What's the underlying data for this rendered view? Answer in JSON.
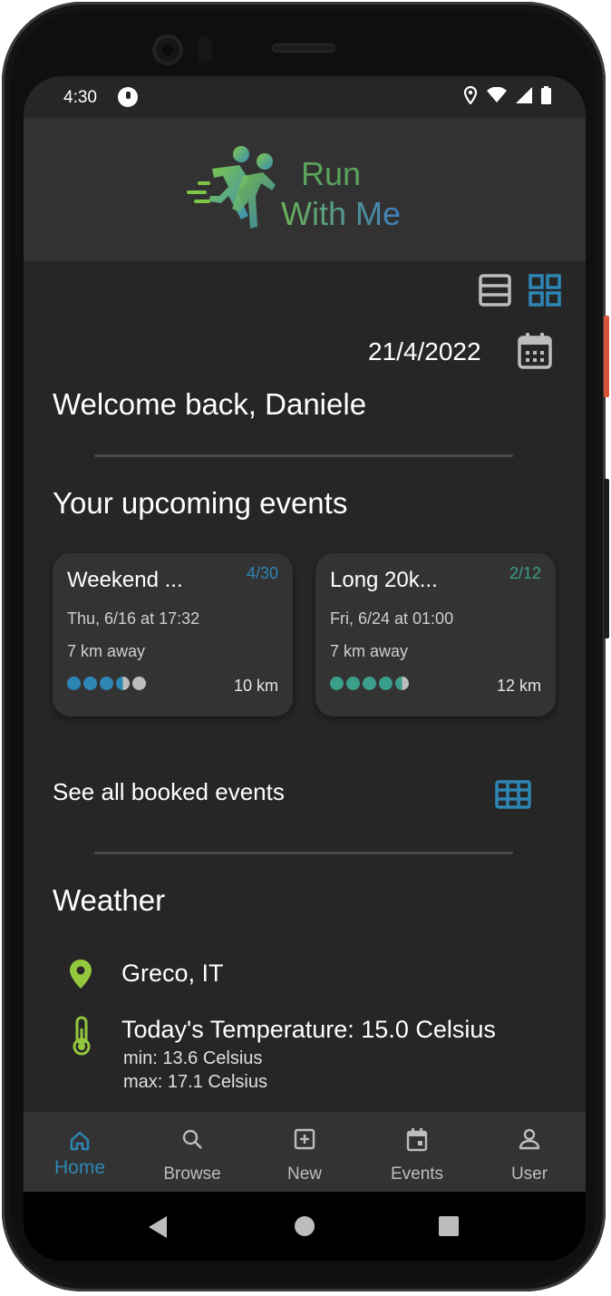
{
  "status_bar": {
    "time": "4:30"
  },
  "app": {
    "logo_line1": "Run",
    "logo_line2": "With Me"
  },
  "colors": {
    "accent_blue": "#2e86b5",
    "accent_teal": "#3a9e8a",
    "accent_green": "#93c83e"
  },
  "date": "21/4/2022",
  "welcome": "Welcome back, Daniele",
  "upcoming": {
    "title": "Your upcoming events",
    "events": [
      {
        "name": "Weekend ...",
        "count": "4/30",
        "date": "Thu, 6/16 at 17:32",
        "distance_away": "7 km away",
        "length": "10 km",
        "difficulty": 3.5
      },
      {
        "name": "Long 20k...",
        "count": "2/12",
        "date": "Fri, 6/24 at 01:00",
        "distance_away": "7 km away",
        "length": "12 km",
        "difficulty": 4.5
      }
    ]
  },
  "see_all": {
    "label": "See all booked events"
  },
  "weather": {
    "title": "Weather",
    "location": "Greco, IT",
    "temperature": "Today's Temperature: 15.0 Celsius",
    "min": "min: 13.6 Celsius",
    "max": "max: 17.1 Celsius"
  },
  "nav": {
    "home": "Home",
    "browse": "Browse",
    "new": "New",
    "events": "Events",
    "user": "User"
  }
}
